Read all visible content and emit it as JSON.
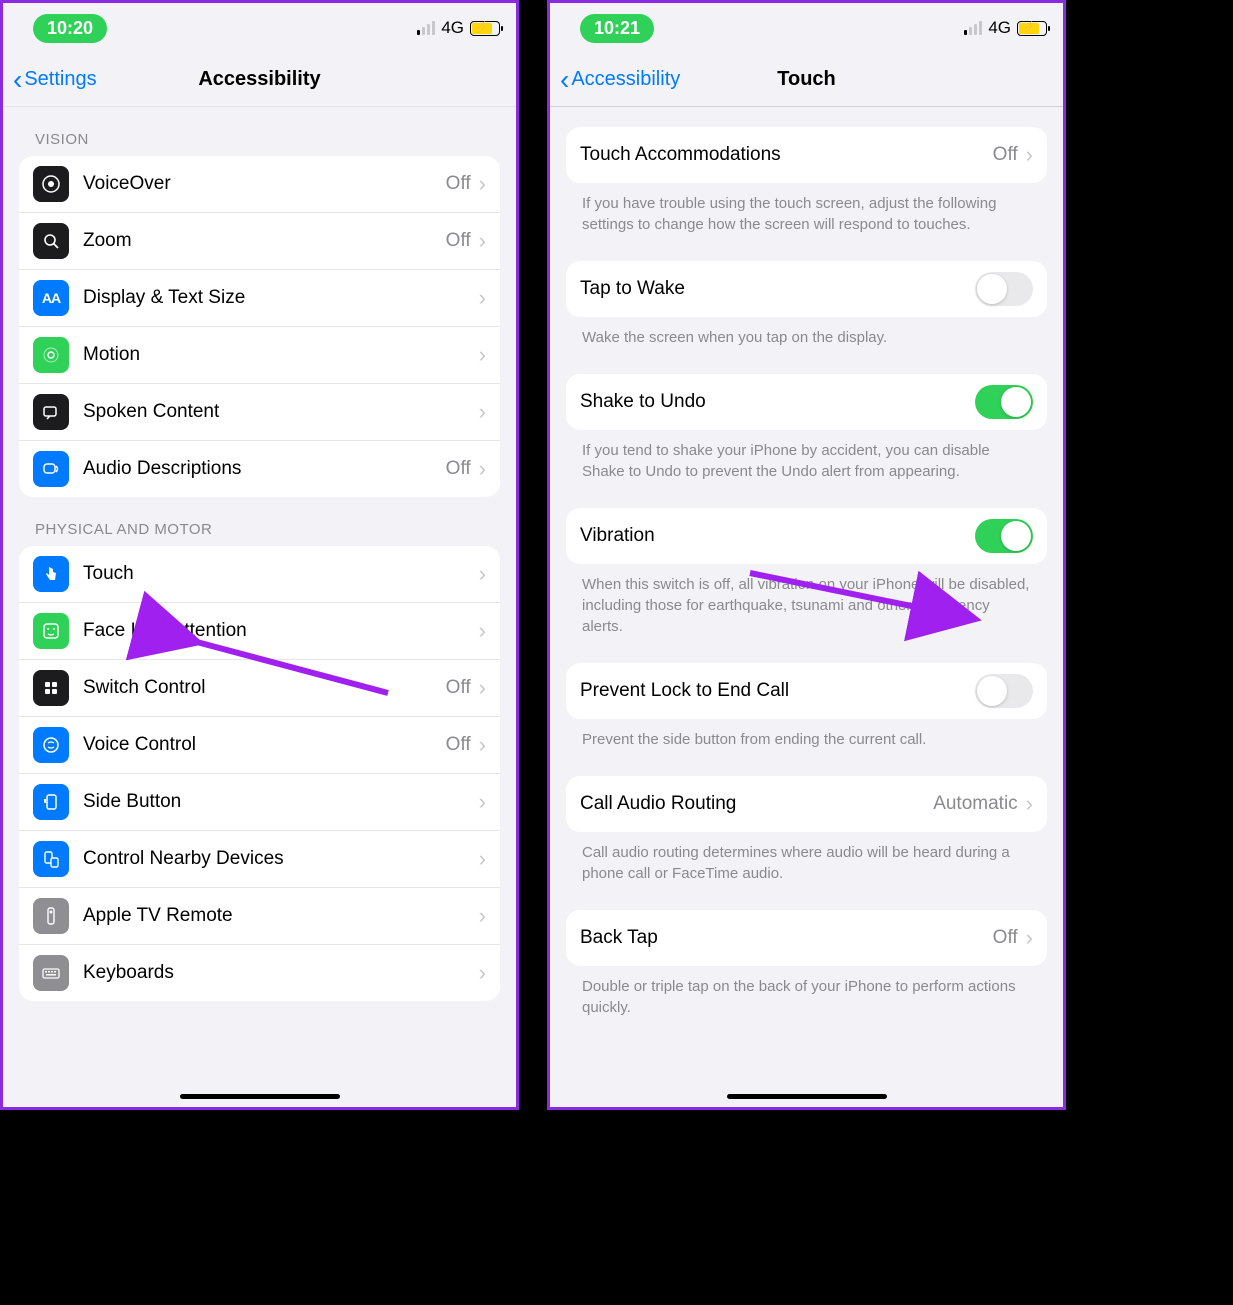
{
  "left": {
    "status": {
      "time": "10:20",
      "network": "4G"
    },
    "nav": {
      "back": "Settings",
      "title": "Accessibility"
    },
    "sections": [
      {
        "header": "Vision",
        "rows": [
          {
            "label": "VoiceOver",
            "value": "Off",
            "icon": "voiceover"
          },
          {
            "label": "Zoom",
            "value": "Off",
            "icon": "zoom"
          },
          {
            "label": "Display & Text Size",
            "value": "",
            "icon": "displaytext"
          },
          {
            "label": "Motion",
            "value": "",
            "icon": "motion"
          },
          {
            "label": "Spoken Content",
            "value": "",
            "icon": "spoken"
          },
          {
            "label": "Audio Descriptions",
            "value": "Off",
            "icon": "audiodesc"
          }
        ]
      },
      {
        "header": "Physical and Motor",
        "rows": [
          {
            "label": "Touch",
            "value": "",
            "icon": "touch"
          },
          {
            "label": "Face ID & Attention",
            "value": "",
            "icon": "faceid"
          },
          {
            "label": "Switch Control",
            "value": "Off",
            "icon": "switch"
          },
          {
            "label": "Voice Control",
            "value": "Off",
            "icon": "voicecontrol"
          },
          {
            "label": "Side Button",
            "value": "",
            "icon": "sidebutton"
          },
          {
            "label": "Control Nearby Devices",
            "value": "",
            "icon": "nearby"
          },
          {
            "label": "Apple TV Remote",
            "value": "",
            "icon": "tvremote"
          },
          {
            "label": "Keyboards",
            "value": "",
            "icon": "keyboards"
          }
        ]
      }
    ]
  },
  "right": {
    "status": {
      "time": "10:21",
      "network": "4G"
    },
    "nav": {
      "back": "Accessibility",
      "title": "Touch"
    },
    "groups": [
      {
        "rows": [
          {
            "label": "Touch Accommodations",
            "value": "Off",
            "type": "chevron"
          }
        ],
        "footer": "If you have trouble using the touch screen, adjust the following settings to change how the screen will respond to touches."
      },
      {
        "rows": [
          {
            "label": "Tap to Wake",
            "type": "toggle",
            "on": false
          }
        ],
        "footer": "Wake the screen when you tap on the display."
      },
      {
        "rows": [
          {
            "label": "Shake to Undo",
            "type": "toggle",
            "on": true
          }
        ],
        "footer": "If you tend to shake your iPhone by accident, you can disable Shake to Undo to prevent the Undo alert from appearing."
      },
      {
        "rows": [
          {
            "label": "Vibration",
            "type": "toggle",
            "on": true
          }
        ],
        "footer": "When this switch is off, all vibration on your iPhone will be disabled, including those for earthquake, tsunami and other emergency alerts."
      },
      {
        "rows": [
          {
            "label": "Prevent Lock to End Call",
            "type": "toggle",
            "on": false
          }
        ],
        "footer": "Prevent the side button from ending the current call."
      },
      {
        "rows": [
          {
            "label": "Call Audio Routing",
            "value": "Automatic",
            "type": "chevron"
          }
        ],
        "footer": "Call audio routing determines where audio will be heard during a phone call or FaceTime audio."
      },
      {
        "rows": [
          {
            "label": "Back Tap",
            "value": "Off",
            "type": "chevron"
          }
        ],
        "footer": "Double or triple tap on the back of your iPhone to perform actions quickly."
      }
    ]
  }
}
